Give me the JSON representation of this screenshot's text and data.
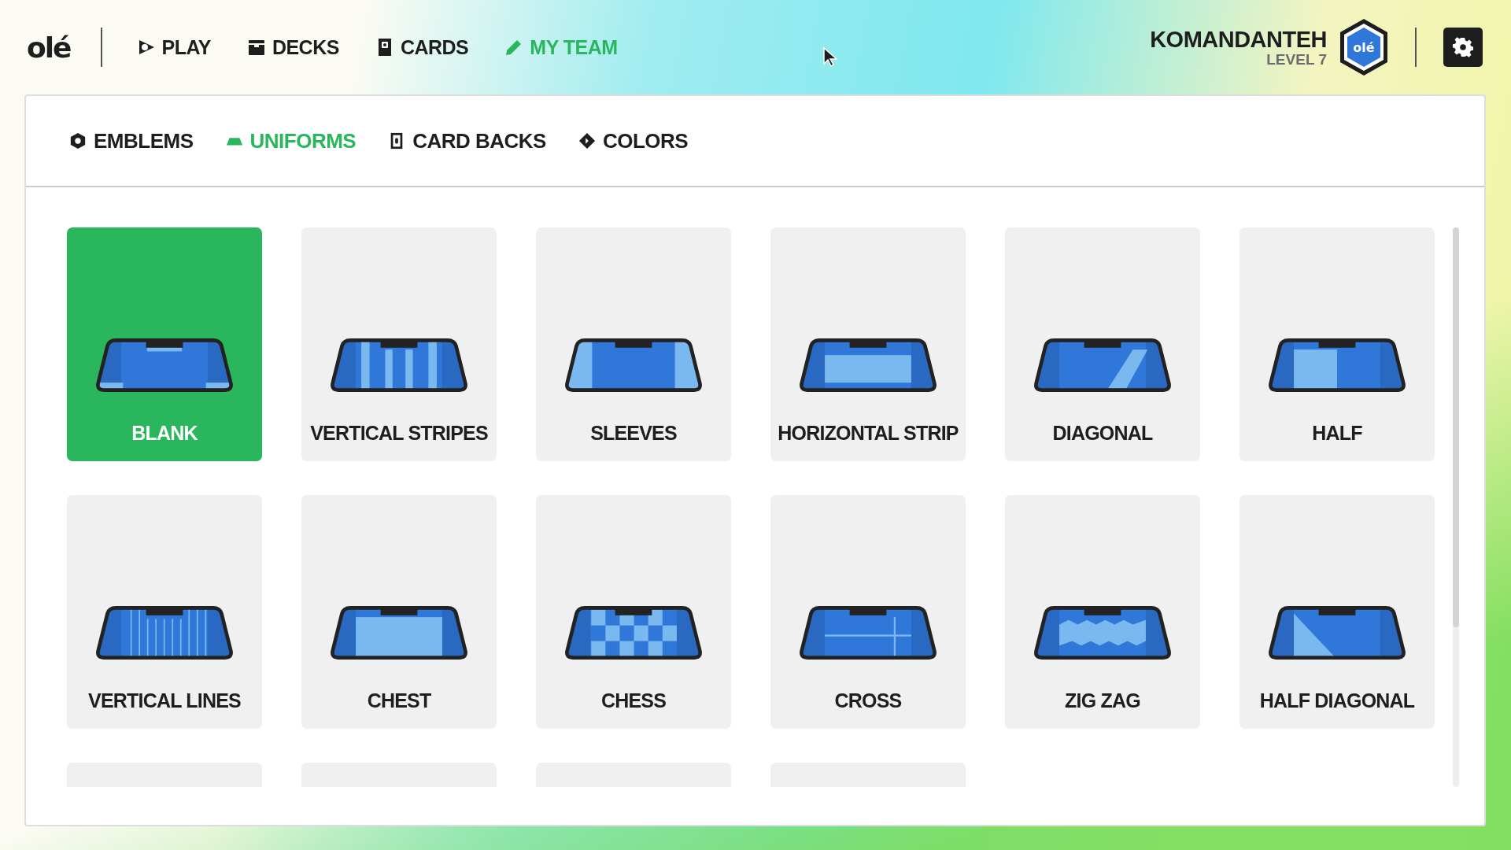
{
  "logo": "olé",
  "nav": [
    {
      "label": "PLAY",
      "kind": "play",
      "selected": false
    },
    {
      "label": "DECKS",
      "kind": "deck",
      "selected": false
    },
    {
      "label": "CARDS",
      "kind": "card",
      "selected": false
    },
    {
      "label": "MY TEAM",
      "kind": "pencil",
      "selected": true
    }
  ],
  "profile": {
    "name": "KOMANDANTEH",
    "level": "LEVEL 7",
    "emblem": "olé"
  },
  "tabs": [
    {
      "label": "EMBLEMS",
      "kind": "hexagon",
      "selected": false
    },
    {
      "label": "UNIFORMS",
      "kind": "uniform",
      "selected": true
    },
    {
      "label": "CARD BACKS",
      "kind": "cardback",
      "selected": false
    },
    {
      "label": "COLORS",
      "kind": "diamond",
      "selected": false
    }
  ],
  "uniforms": [
    {
      "label": "BLANK",
      "kind": "blank",
      "selected": true
    },
    {
      "label": "VERTICAL STRIPES",
      "kind": "stripes",
      "selected": false
    },
    {
      "label": "SLEEVES",
      "kind": "sleeves",
      "selected": false
    },
    {
      "label": "HORIZONTAL STRIP",
      "kind": "horizontal",
      "selected": false
    },
    {
      "label": "DIAGONAL",
      "kind": "diagonal",
      "selected": false
    },
    {
      "label": "HALF",
      "kind": "half",
      "selected": false
    },
    {
      "label": "VERTICAL LINES",
      "kind": "lines",
      "selected": false
    },
    {
      "label": "CHEST",
      "kind": "chest",
      "selected": false
    },
    {
      "label": "CHESS",
      "kind": "chess",
      "selected": false
    },
    {
      "label": "CROSS",
      "kind": "cross",
      "selected": false
    },
    {
      "label": "ZIG ZAG",
      "kind": "zigzag",
      "selected": false
    },
    {
      "label": "HALF DIAGONAL",
      "kind": "halfdiagonal",
      "selected": false
    },
    {
      "selected": false
    },
    {
      "selected": false
    },
    {
      "selected": false
    },
    {
      "selected": false
    }
  ]
}
